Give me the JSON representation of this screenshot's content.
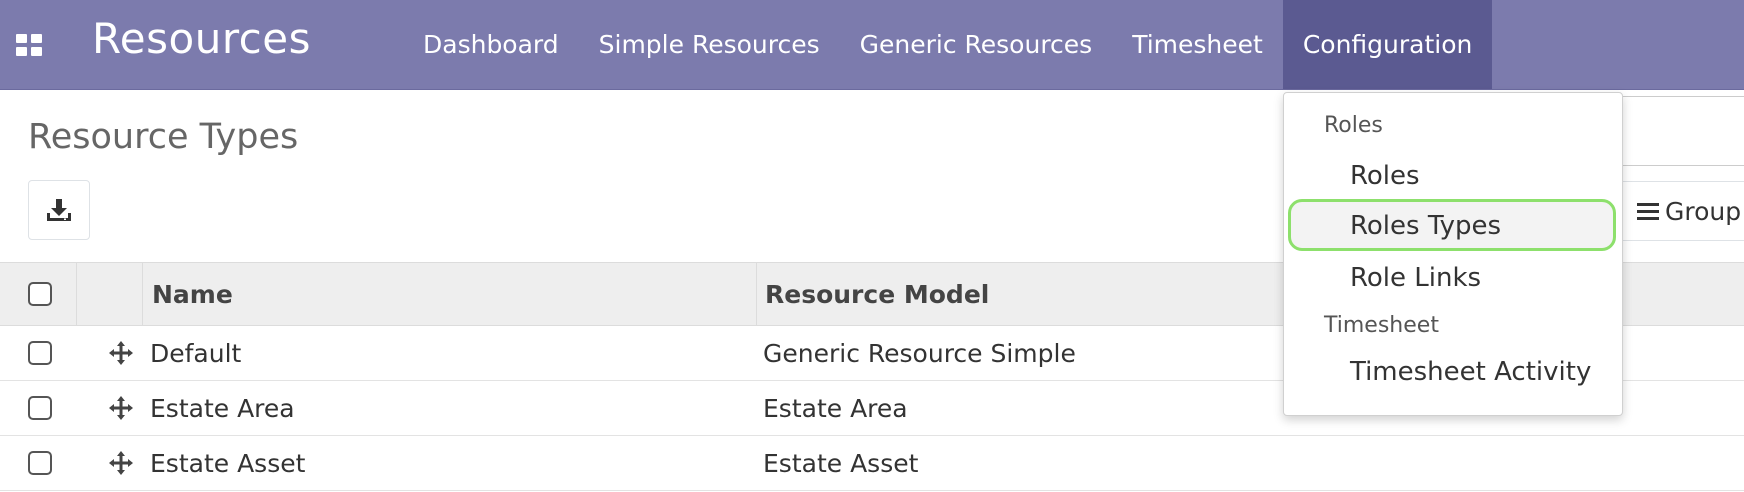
{
  "navbar": {
    "brand": "Resources",
    "menu": [
      {
        "label": "Dashboard"
      },
      {
        "label": "Simple Resources"
      },
      {
        "label": "Generic Resources"
      },
      {
        "label": "Timesheet"
      },
      {
        "label": "Configuration"
      }
    ],
    "active_menu": "Configuration",
    "color": "#7c7bad",
    "active_color": "#5b5a91"
  },
  "page": {
    "title": "Resource Types",
    "group_by_label": "Group"
  },
  "table": {
    "columns": [
      "Name",
      "Resource Model"
    ],
    "rows": [
      {
        "name": "Default",
        "model": "Generic Resource Simple"
      },
      {
        "name": "Estate Area",
        "model": "Estate Area"
      },
      {
        "name": "Estate Asset",
        "model": "Estate Asset"
      }
    ]
  },
  "dropdown": {
    "section_roles": "Roles",
    "roles": "Roles",
    "roles_types": "Roles Types",
    "role_links": "Role Links",
    "section_timesheet": "Timesheet",
    "timesheet_activity": "Timesheet Activity",
    "highlight_color": "#8de06c"
  }
}
